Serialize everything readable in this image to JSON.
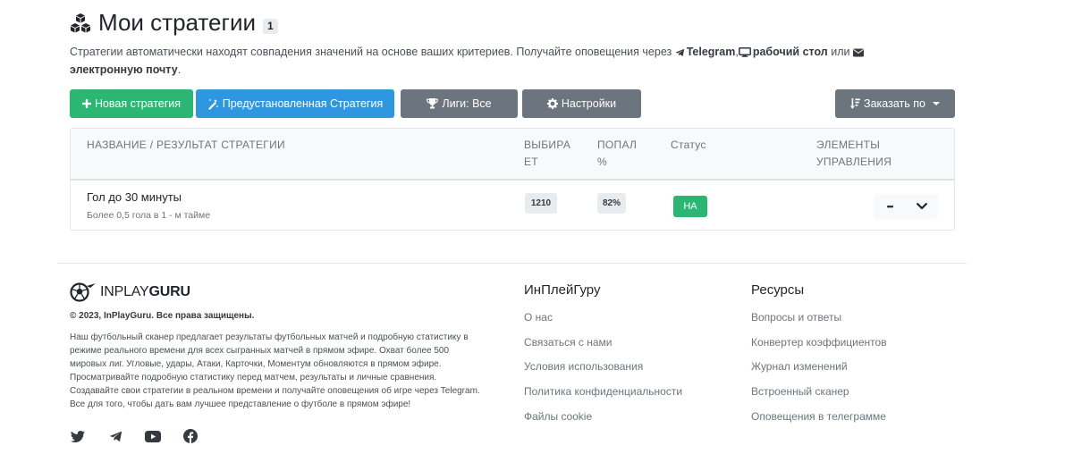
{
  "header": {
    "title": "Мои стратегии",
    "count": "1",
    "title_icon": "cubes-icon"
  },
  "subtitle": {
    "text_before": "Стратегии автоматически находят совпадения значений на основе ваших критериев. Получайте оповещения через ",
    "telegram": "Telegram",
    "comma": ",",
    "desktop": "рабочий стол",
    "or": " или ",
    "email": "электронную почту",
    "period": "."
  },
  "toolbar": {
    "new_label": "Новая стратегия",
    "preset_label": "Предустановленная Стратегия",
    "leagues_label": "Лиги: Все",
    "settings_label": "Настройки",
    "order_label": "Заказать по"
  },
  "table": {
    "headers": {
      "name": "НАЗВАНИЕ / РЕЗУЛЬТАТ СТРАТЕГИИ",
      "picks_1": "ВЫБИРА",
      "picks_2": "ЕТ",
      "hit_1": "ПОПАЛ",
      "hit_2": "%",
      "status": "Статус",
      "controls_1": "ЭЛЕМЕНТЫ",
      "controls_2": "УПРАВЛЕНИЯ"
    },
    "rows": [
      {
        "name": "Гол до 30 минуты",
        "description": "Более 0,5 гола в 1 - м тайме",
        "picks": "1210",
        "hit_rate": "82%",
        "status": "НА",
        "more": "•••"
      }
    ]
  },
  "footer": {
    "logo_plain": "INPLAY",
    "logo_bold": "GURU",
    "copyright": "© 2023, InPlayGuru. Все права защищены.",
    "about": [
      "Наш футбольный сканер предлагает результаты футбольных матчей и подробную статистику в",
      "режиме реального времени для всех сыгранных матчей в прямом эфире. Охват более 500",
      "мировых лиг. Угловые, удары, Атаки, Карточки, Моментум обновляются в прямом эфире.",
      "Просматривайте подробную статистику перед матчем, результаты и личные сравнения.",
      "Создавайте свои стратегии в реальном времени и получайте оповещения об игре через Telegram.",
      "Все для того, чтобы дать вам лучшее представление о футболе в прямом эфире!"
    ],
    "socials": [
      "twitter-icon",
      "telegram-icon",
      "youtube-icon",
      "facebook-icon"
    ],
    "col1": {
      "title": "ИнПлейГуру",
      "links": [
        "О нас",
        "Связаться с нами",
        "Условия использования",
        "Политика конфиденциальности",
        "Файлы cookie"
      ]
    },
    "col2": {
      "title": "Ресурсы",
      "links": [
        "Вопросы и ответы",
        "Конвертер коэффициентов",
        "Журнал изменений",
        "Встроенный сканер",
        "Оповещения в телеграмме"
      ]
    }
  },
  "colors": {
    "green": "#2bb673",
    "blue": "#2f97e0",
    "gray": "#6c757d"
  }
}
